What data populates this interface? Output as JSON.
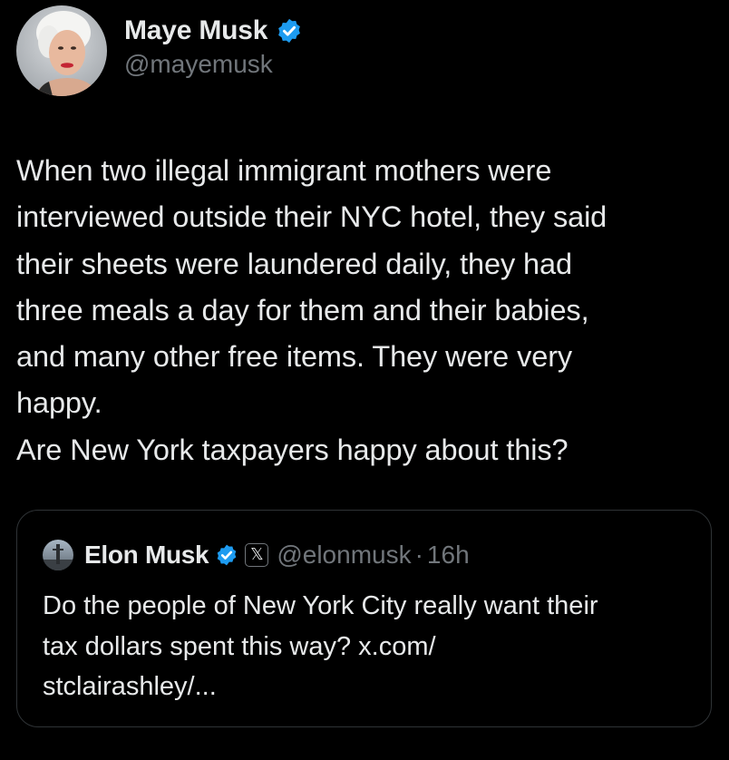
{
  "colors": {
    "background": "#000000",
    "text_primary": "#e7e9ea",
    "text_secondary": "#71767b",
    "verified_blue": "#1d9bf0",
    "card_border": "#2f3336"
  },
  "tweet": {
    "author": {
      "name": "Maye Musk",
      "handle": "@mayemusk",
      "verified_icon": "verified-badge-icon",
      "avatar_icon": "avatar-photo"
    },
    "text_lines": [
      "When two illegal immigrant mothers were",
      "interviewed outside their NYC hotel, they said",
      "their sheets were laundered daily, they had",
      "three meals a day for them and their babies,",
      "and many other free items. They were very",
      "happy.",
      "Are New York taxpayers happy about this?"
    ]
  },
  "quoted_tweet": {
    "author": {
      "name": "Elon Musk",
      "handle": "@elonmusk",
      "verified_icon": "verified-badge-icon",
      "affiliation_badge_glyph": "𝕏",
      "avatar_icon": "avatar-photo"
    },
    "separator": "·",
    "time": "16h",
    "text_lines": [
      "Do the people of New York City really want their",
      "tax dollars spent this way? x.com/",
      "stclairashley/..."
    ]
  }
}
